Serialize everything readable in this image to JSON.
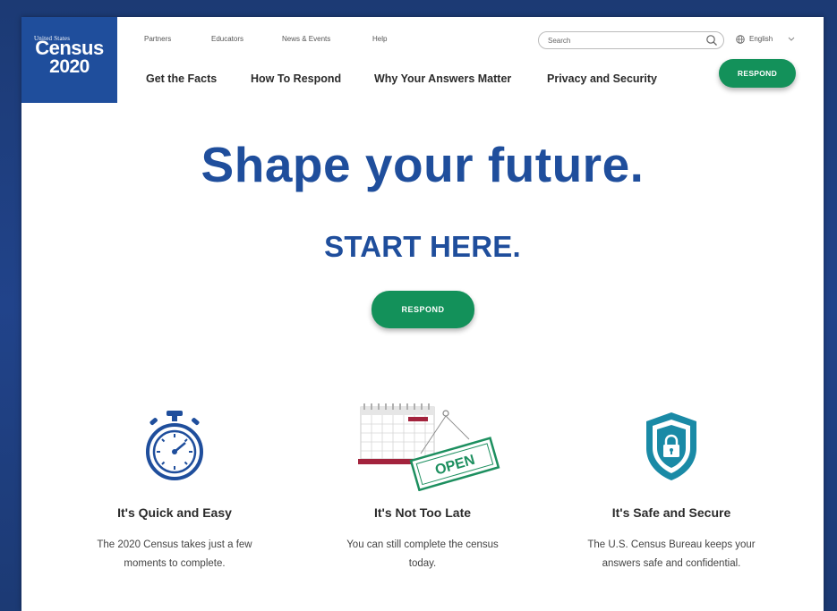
{
  "logo": {
    "top_text": "United States",
    "main_text": "Census",
    "year_text": "2020"
  },
  "utility_nav": [
    "Partners",
    "Educators",
    "News & Events",
    "Help"
  ],
  "search": {
    "placeholder": "Search"
  },
  "language": {
    "label": "English"
  },
  "main_nav": [
    "Get the Facts",
    "How To Respond",
    "Why Your Answers Matter",
    "Privacy and Security"
  ],
  "header_respond_label": "RESPOND",
  "hero": {
    "title": "Shape your future.",
    "subtitle": "START HERE.",
    "respond_label": "RESPOND"
  },
  "features": [
    {
      "icon": "stopwatch-icon",
      "title": "It's Quick and Easy",
      "line1": "The 2020 Census takes just a few",
      "line2": "moments to complete."
    },
    {
      "icon": "calendar-open-sign-icon",
      "title": "It's Not Too Late",
      "line1": "You can still complete the census",
      "line2": "today.",
      "sign_text": "OPEN"
    },
    {
      "icon": "shield-lock-icon",
      "title": "It's Safe and Secure",
      "line1": "The U.S. Census Bureau keeps your",
      "line2": "answers safe and confidential."
    }
  ],
  "colors": {
    "brand_blue": "#1f4e9c",
    "respond_green": "#13915a",
    "background_navy": "#1e3f7d",
    "shield_teal": "#1a8aa6",
    "calendar_red": "#a3233d"
  }
}
